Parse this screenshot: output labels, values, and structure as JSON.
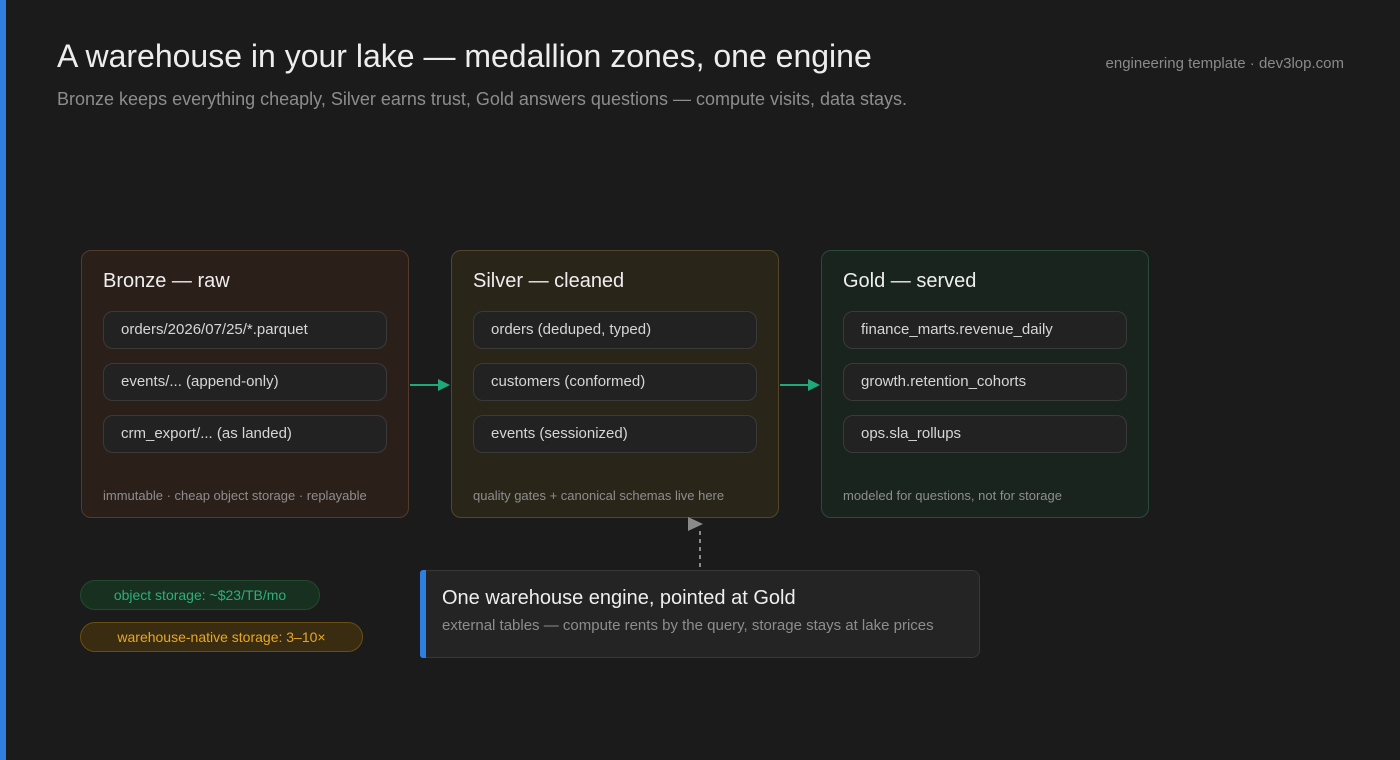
{
  "header": {
    "title": "A warehouse in your lake — medallion zones, one engine",
    "subtitle": "Bronze keeps everything cheaply, Silver earns trust, Gold answers questions — compute visits, data stays.",
    "brand": "engineering template · dev3lop.com"
  },
  "zones": [
    {
      "title": "Bronze — raw",
      "items": [
        "orders/2026/07/25/*.parquet",
        "events/... (append-only)",
        "crm_export/... (as landed)"
      ],
      "note": "immutable · cheap object storage · replayable"
    },
    {
      "title": "Silver — cleaned",
      "items": [
        "orders (deduped, typed)",
        "customers (conformed)",
        "events (sessionized)"
      ],
      "note": "quality gates + canonical schemas live here"
    },
    {
      "title": "Gold — served",
      "items": [
        "finance_marts.revenue_daily",
        "growth.retention_cohorts",
        "ops.sla_rollups"
      ],
      "note": "modeled for questions, not for storage"
    }
  ],
  "callout": {
    "title": "One warehouse engine, pointed at Gold",
    "body": "external tables — compute rents by the query, storage stays at lake prices"
  },
  "pills": {
    "object_storage": "object storage: ~$23/TB/mo",
    "warehouse_storage": "warehouse-native storage: 3–10×"
  },
  "colors": {
    "accent": "#2f7fe0",
    "flow_arrow": "#1fa97a",
    "bronze_border": "#55392a",
    "silver_border": "#54462a",
    "gold_border": "#2b4a3a",
    "pill_green_text": "#2fae7a",
    "pill_amber_text": "#e8a825"
  }
}
